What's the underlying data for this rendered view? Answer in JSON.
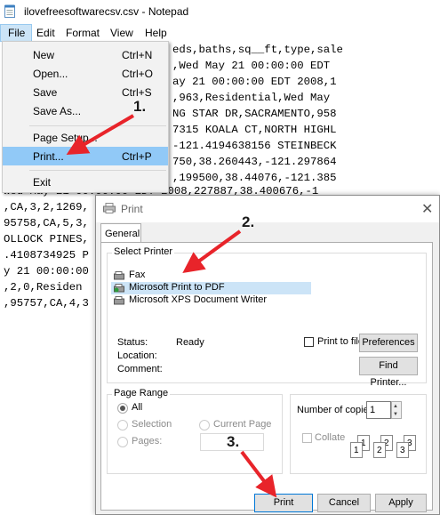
{
  "notepad": {
    "title": "ilovefreesoftwarecsv.csv - Notepad",
    "menu": [
      "File",
      "Edit",
      "Format",
      "View",
      "Help"
    ],
    "lines": [
      "eds,baths,sq__ft,type,sale",
      ",Wed May 21 00:00:00 EDT",
      "ay 21 00:00:00 EDT 2008,1",
      ",963,Residential,Wed May",
      "NG STAR DR,SACRAMENTO,958",
      "7315 KOALA CT,NORTH HIGHL",
      "-121.4194638156 STEINBECK",
      "750,38.260443,-121.297864",
      ",199500,38.44076,-121.385",
      "Wed May 21 00:00:00 EDT 2008,227887,38.400676,-1",
      ",CA,3,2,1269,",
      "95758,CA,5,3,",
      "OLLOCK PINES,",
      ".4108734925 P",
      "y 21 00:00:00",
      ",2,0,Residen",
      ",95757,CA,4,3"
    ]
  },
  "file_menu": {
    "items": [
      {
        "label": "New",
        "shortcut": "Ctrl+N"
      },
      {
        "label": "Open...",
        "shortcut": "Ctrl+O"
      },
      {
        "label": "Save",
        "shortcut": "Ctrl+S"
      },
      {
        "label": "Save As...",
        "shortcut": ""
      },
      {
        "label": "Page Setup...",
        "shortcut": ""
      },
      {
        "label": "Print...",
        "shortcut": "Ctrl+P"
      },
      {
        "label": "Exit",
        "shortcut": ""
      }
    ]
  },
  "print_dialog": {
    "title": "Print",
    "tab": "General",
    "select_printer_label": "Select Printer",
    "printers": [
      "Fax",
      "Microsoft Print to PDF",
      "Microsoft XPS Document Writer"
    ],
    "selected_printer": "Microsoft Print to PDF",
    "status_label": "Status:",
    "status_value": "Ready",
    "location_label": "Location:",
    "comment_label": "Comment:",
    "print_to_file_label": "Print to file",
    "preferences_button": "Preferences",
    "find_printer_button": "Find Printer...",
    "page_range_label": "Page Range",
    "range_all": "All",
    "range_selection": "Selection",
    "range_current_page": "Current Page",
    "range_pages": "Pages:",
    "copies_label": "Number of copies:",
    "copies_value": "1",
    "collate_label": "Collate",
    "collate_pages": [
      "1",
      "1",
      "2",
      "2",
      "3",
      "3"
    ],
    "print_button": "Print",
    "cancel_button": "Cancel",
    "apply_button": "Apply"
  },
  "annotations": {
    "step1": "1.",
    "step2": "2.",
    "step3": "3.",
    "arrow_color": "#e8242a"
  }
}
